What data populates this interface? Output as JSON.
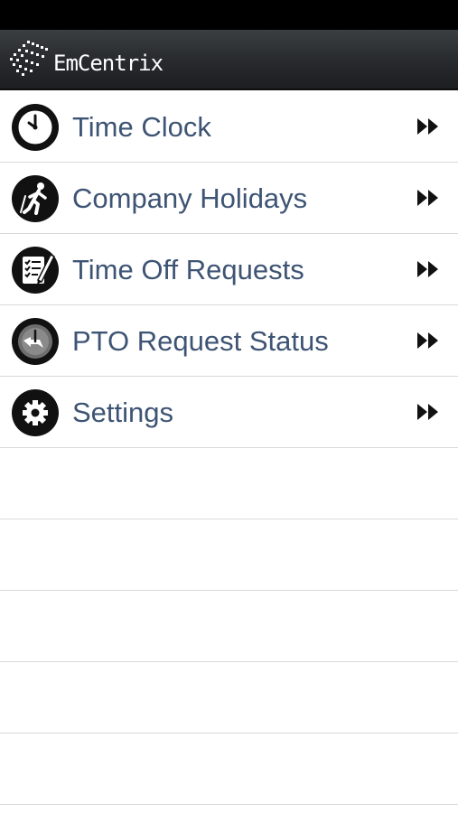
{
  "app": {
    "title": "EmCentrix"
  },
  "menu": {
    "items": [
      {
        "label": "Time Clock",
        "icon": "clock-icon"
      },
      {
        "label": "Company Holidays",
        "icon": "person-walking-icon"
      },
      {
        "label": "Time Off Requests",
        "icon": "checklist-pencil-icon"
      },
      {
        "label": "PTO Request Status",
        "icon": "clock-arrow-icon"
      },
      {
        "label": "Settings",
        "icon": "gear-icon"
      }
    ],
    "chevron_icon": "double-chevron-right-icon"
  },
  "colors": {
    "header_bg": "#2a2d30",
    "status_bar": "#000000",
    "label_text": "#3e5474",
    "divider": "#d9d9d9",
    "icon_bg": "#111111"
  }
}
